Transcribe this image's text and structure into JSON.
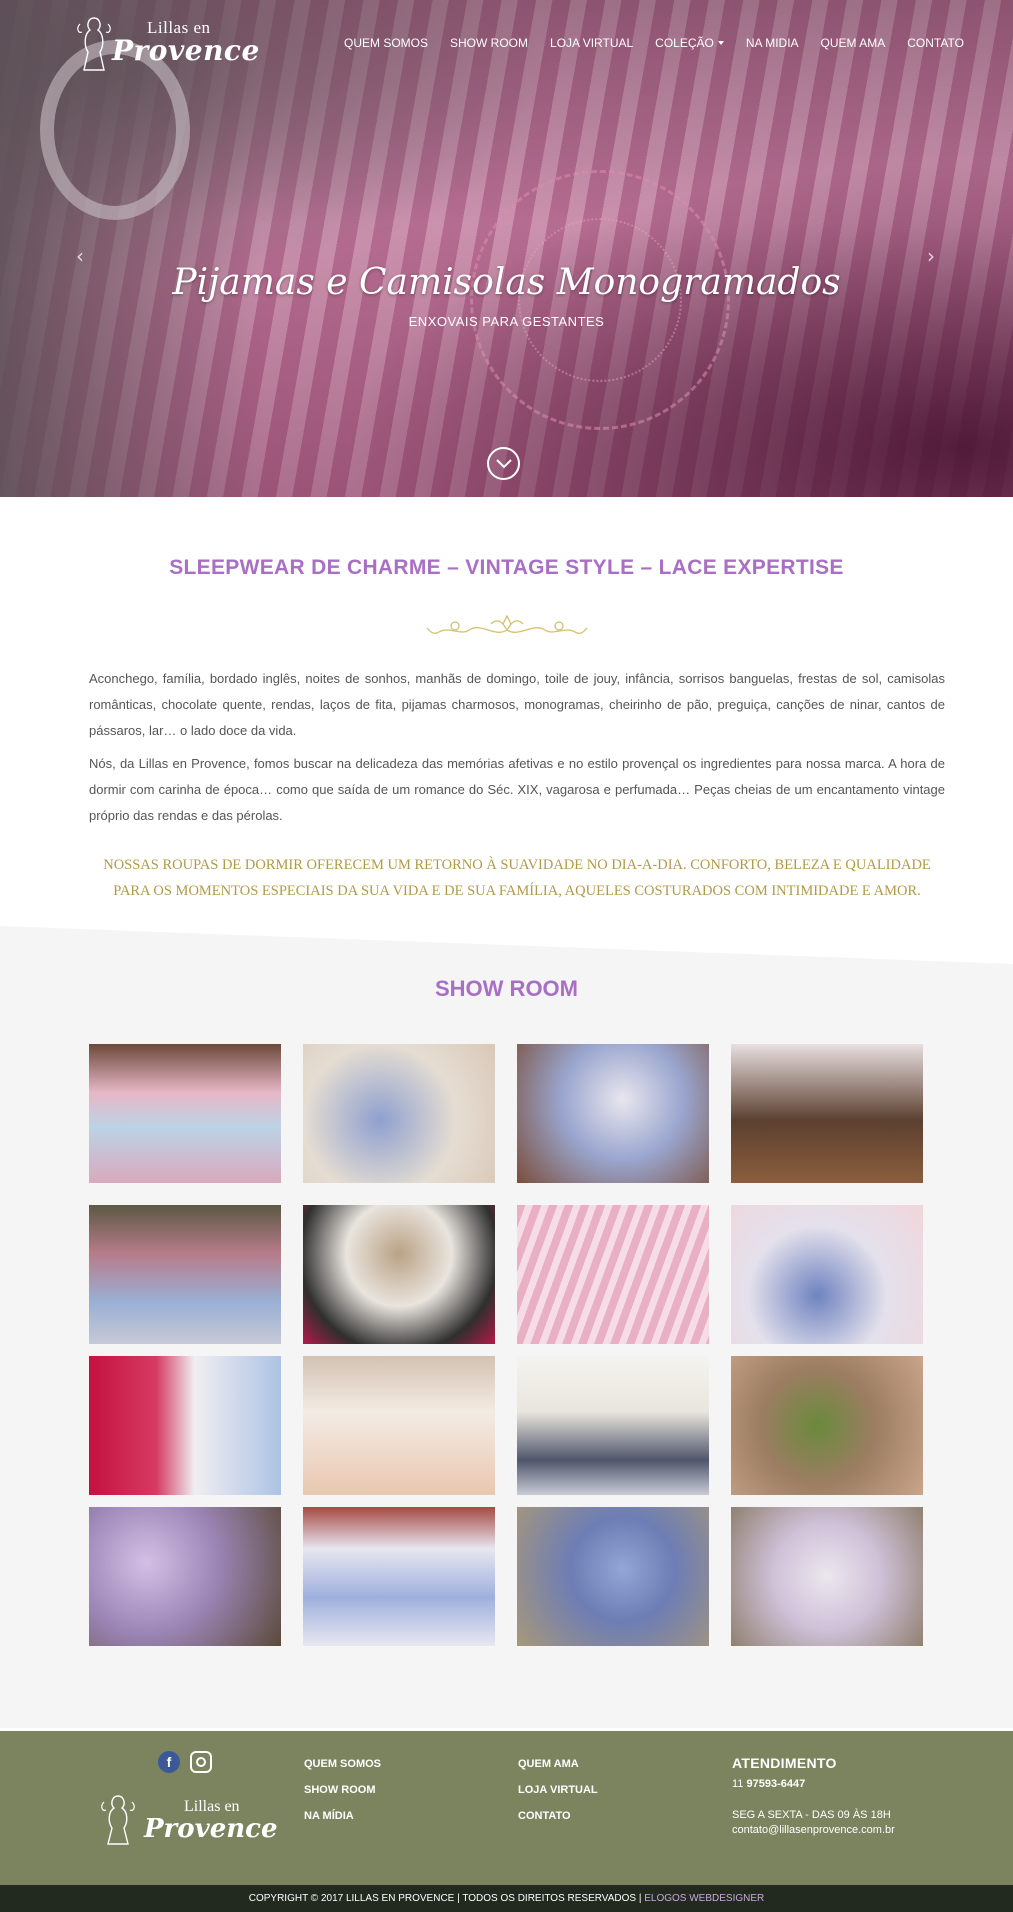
{
  "brand": {
    "logo_line1": "Lillas en",
    "logo_line2": "Provence"
  },
  "nav": {
    "items": [
      {
        "label": "QUEM SOMOS"
      },
      {
        "label": "SHOW ROOM"
      },
      {
        "label": "LOJA VIRTUAL"
      },
      {
        "label": "COLEÇÃO",
        "has_dropdown": true
      },
      {
        "label": "NA MIDIA"
      },
      {
        "label": "QUEM AMA"
      },
      {
        "label": "CONTATO"
      }
    ]
  },
  "hero": {
    "title": "Pijamas e Camisolas Monogramados",
    "subtitle": "ENXOVAIS PARA GESTANTES",
    "prev_arrow": "‹",
    "next_arrow": "›",
    "colors": {
      "stripe_dark": "#c2769c",
      "stripe_light": "#dba0bd"
    }
  },
  "intro": {
    "title": "SLEEPWEAR DE CHARME – VINTAGE STYLE – LACE EXPERTISE",
    "paragraph1": "Aconchego, família, bordado inglês, noites de sonhos, manhãs de domingo, toile de jouy, infância, sorrisos banguelas, frestas de sol, camisolas românticas, chocolate quente, rendas, laços de fita, pijamas charmosos, monogramas, cheirinho de pão, preguiça, canções de ninar, cantos de pássaros, lar… o lado doce da vida.",
    "paragraph2": "Nós, da Lillas en Provence, fomos buscar na delicadeza das memórias afetivas e no estilo provençal os ingredientes para nossa marca. A hora de dormir com carinha de época… como que saída de um romance do Séc. XIX, vagarosa e perfumada… Peças cheias de um encantamento vintage próprio das rendas e das pérolas.",
    "quote": "NOSSAS ROUPAS DE DORMIR OFERECEM UM RETORNO À SUAVIDADE NO DIA-A-DIA. CONFORTO, BELEZA E QUALIDADE PARA OS MOMENTOS ESPECIAIS DA SUA VIDA E DE SUA FAMÍLIA, AQUELES COSTURADOS COM INTIMIDADE E AMOR.",
    "colors": {
      "title": "#a96fc4",
      "quote": "#b09a47",
      "ornament": "#d8bf6a"
    }
  },
  "showroom": {
    "title": "SHOW ROOM",
    "photos": [
      {
        "bg": "linear-gradient(180deg,#6b4a3a 0%,#e7b7c6 35%,#bcd3e6 60%,#d9a9bd 100%)"
      },
      {
        "bg": "radial-gradient(circle at 40% 55%,#8fa0cf 0%,#e5ddd2 55%,#d9c8b8 100%)"
      },
      {
        "bg": "radial-gradient(circle at 55% 40%,#e9e6ee 0%,#9aa6cf 45%,#7a4e3b 100%)"
      },
      {
        "bg": "linear-gradient(180deg,#e8dfe0 0%,#5b4030 55%,#8b5e3d 100%)"
      },
      {
        "bg": "linear-gradient(180deg,#5c5844 0%,#b77c8a 35%,#9ab0d5 70%,#c7c9d7 100%)"
      },
      {
        "bg": "radial-gradient(circle at 50% 35%,#b9a285 0%,#e9e4de 40%,#2f2f2f 75%,#b41a48 100%)"
      },
      {
        "bg": "repeating-linear-gradient(110deg,#e9b0c4 0px,#e9b0c4 8px,#f5dce6 8px,#f5dce6 15px)"
      },
      {
        "bg": "radial-gradient(circle at 45% 65%,#6f83c0 0%,#e4e1ec 50%,#f0d6da 100%)"
      },
      {
        "bg": "linear-gradient(90deg,#c4123f 0%,#d63a62 35%,#f0eef2 55%,#adc3e3 100%)"
      },
      {
        "bg": "linear-gradient(180deg,#d2c2b2 0%,#f3ebe4 40%,#e9c7b0 100%)"
      },
      {
        "bg": "linear-gradient(180deg,#f3f3f0 0%,#e9e6dd 40%,#4f556b 75%,#c9ccd6 100%)"
      },
      {
        "bg": "radial-gradient(circle at 45% 50%,#6a8a3c 0%,#9c7d62 45%,#c9a58a 100%)"
      },
      {
        "bg": "radial-gradient(circle at 30% 40%,#d4c0e5 0%,#9b85b6 45%,#5b4a3a 100%)"
      },
      {
        "bg": "linear-gradient(180deg,#a54a43 0%,#e8e6f0 30%,#9fb0de 65%,#e7e7f0 100%)"
      },
      {
        "bg": "radial-gradient(circle at 55% 45%,#93a6d4 0%,#6d7db5 40%,#a8987a 100%)"
      },
      {
        "bg": "radial-gradient(circle at 50% 50%,#ece7ee 0%,#cfc1d8 45%,#8f8070 100%)"
      }
    ]
  },
  "footer": {
    "social": {
      "facebook_glyph": "f"
    },
    "links_col1": [
      "QUEM SOMOS",
      "SHOW ROOM",
      "NA MÍDIA"
    ],
    "links_col2": [
      "QUEM AMA",
      "LOJA VIRTUAL",
      "CONTATO"
    ],
    "atendimento": {
      "title": "ATENDIMENTO",
      "phone_prefix": "11",
      "phone": "97593-6447",
      "hours": "SEG A SEXTA - DAS 09 ÀS 18H",
      "email": "contato@lillasenprovence.com.br"
    },
    "copyright": "COPYRIGHT © 2017 LILLAS EN PROVENCE | TODOS OS DIREITOS RESERVADOS |",
    "developer": "ELOGOS WEBDESIGNER",
    "colors": {
      "background": "#7b845e",
      "bottom_bar": "#222a20"
    }
  }
}
